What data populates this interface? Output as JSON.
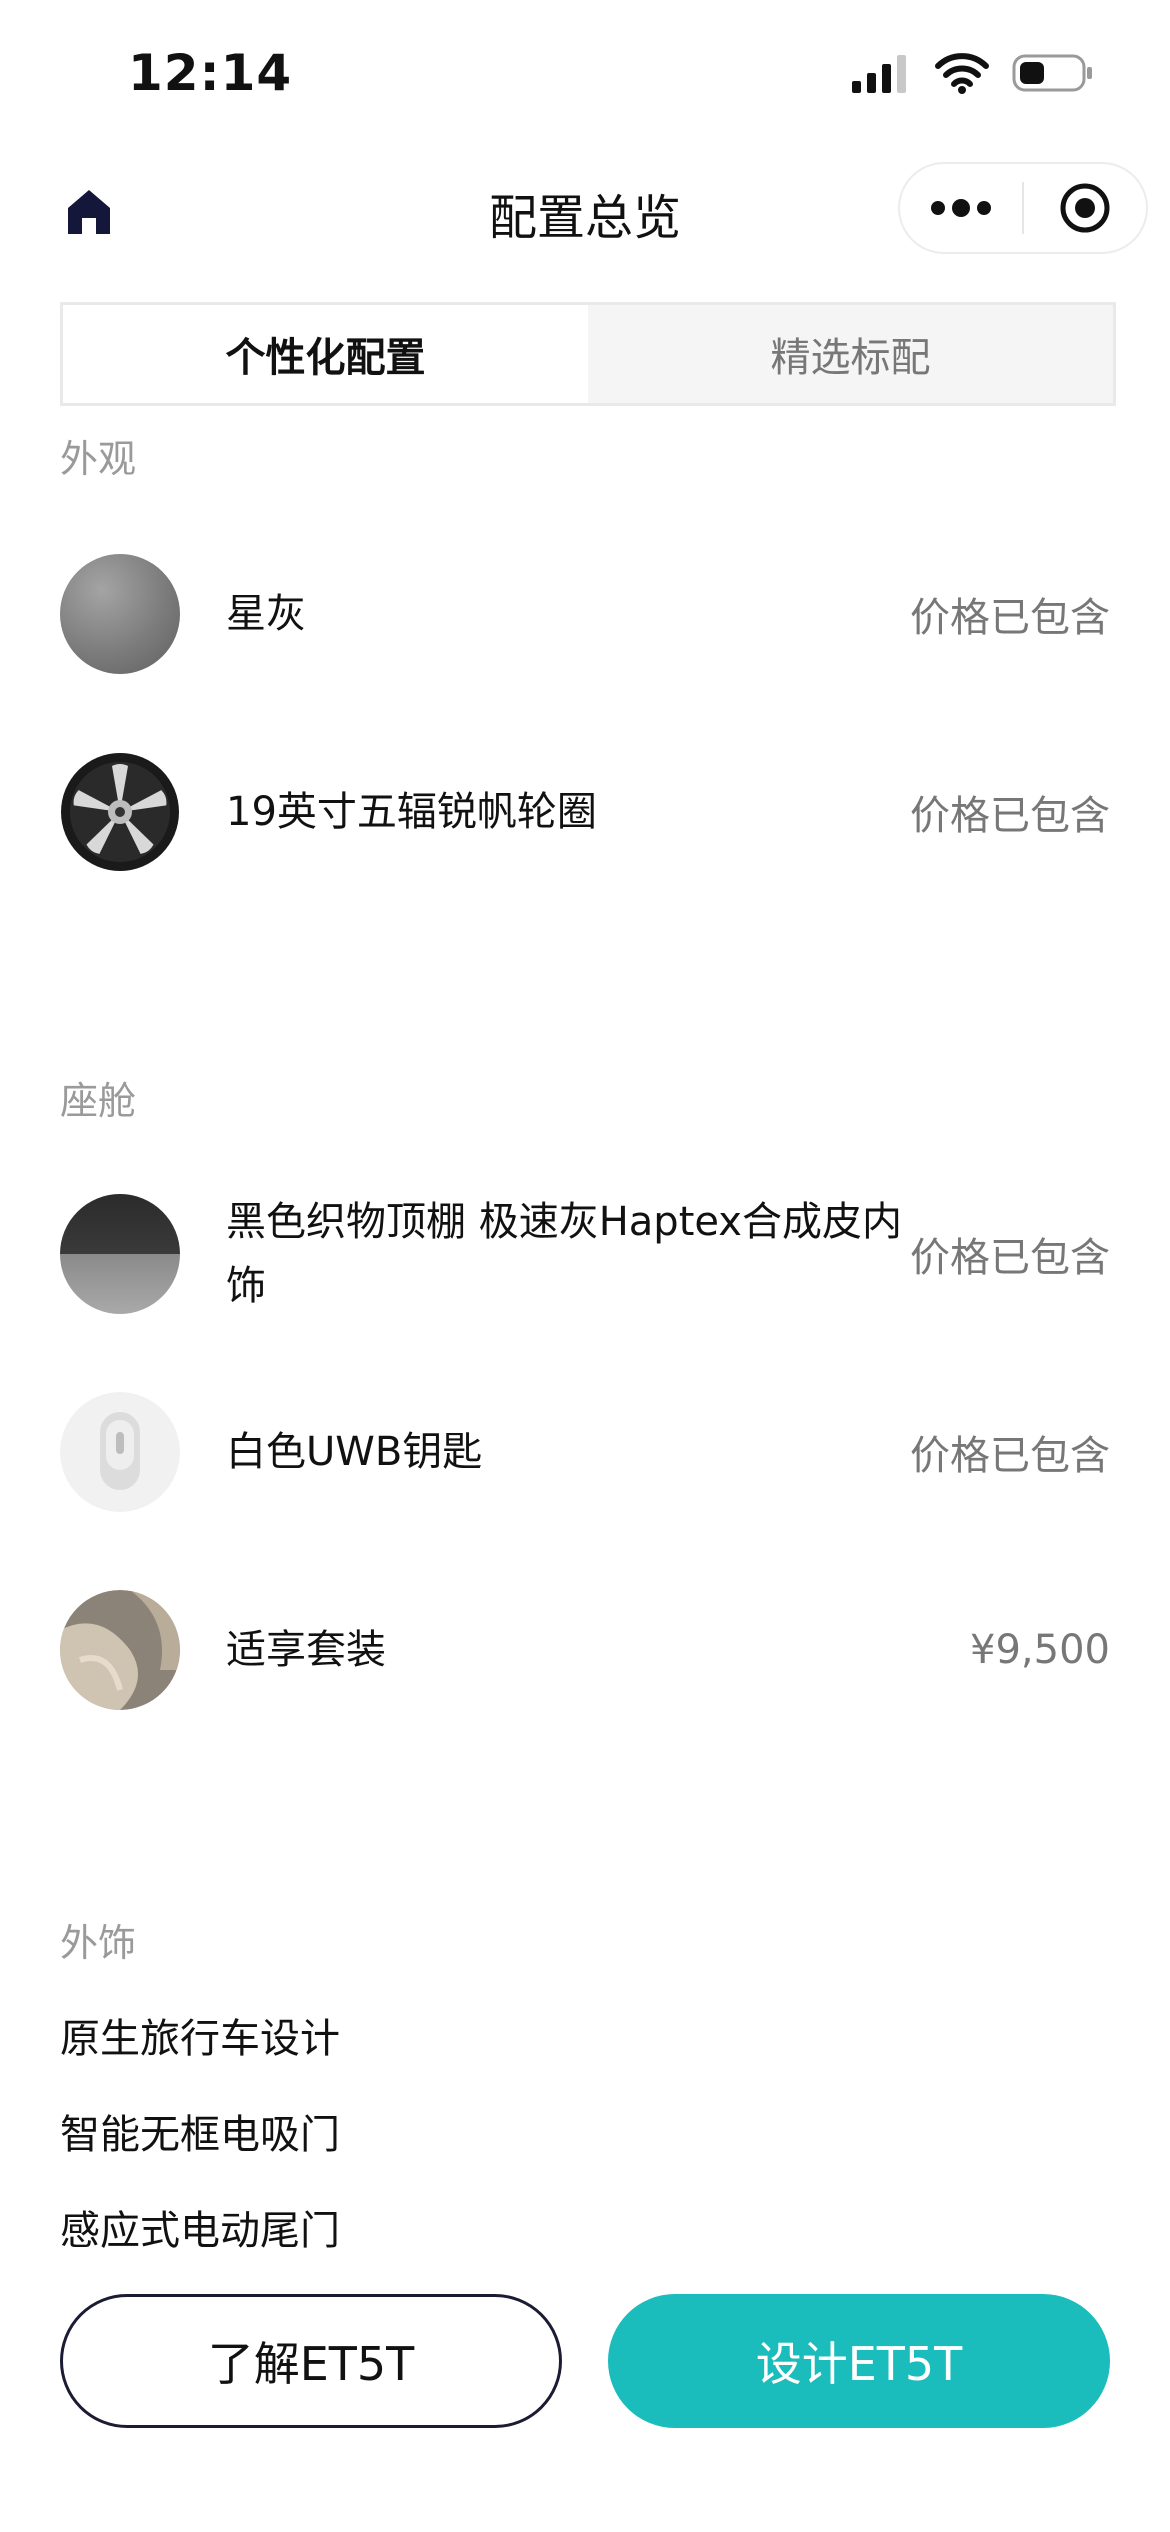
{
  "status_bar": {
    "time": "12:14"
  },
  "nav": {
    "title": "配置总览"
  },
  "tabs": [
    {
      "label": "个性化配置",
      "active": true
    },
    {
      "label": "精选标配",
      "active": false
    }
  ],
  "sections": {
    "exterior": {
      "label": "外观",
      "items": [
        {
          "name": "星灰",
          "price": "价格已包含"
        },
        {
          "name": "19英寸五辐锐帆轮圈",
          "price": "价格已包含"
        }
      ]
    },
    "cabin": {
      "label": "座舱",
      "items": [
        {
          "name": "黑色织物顶棚 极速灰Haptex合成皮内饰",
          "price": "价格已包含"
        },
        {
          "name": "白色UWB钥匙",
          "price": "价格已包含"
        },
        {
          "name": "适享套装",
          "price": "¥9,500"
        }
      ]
    },
    "trim": {
      "label": "外饰",
      "features": [
        "原生旅行车设计",
        "智能无框电吸门",
        "感应式电动尾门"
      ]
    }
  },
  "actions": {
    "learn_label": "了解ET5T",
    "design_label": "设计ET5T"
  },
  "colors": {
    "accent": "#1bbcbc",
    "dark": "#1b1b33",
    "muted": "#9a9a9a"
  }
}
